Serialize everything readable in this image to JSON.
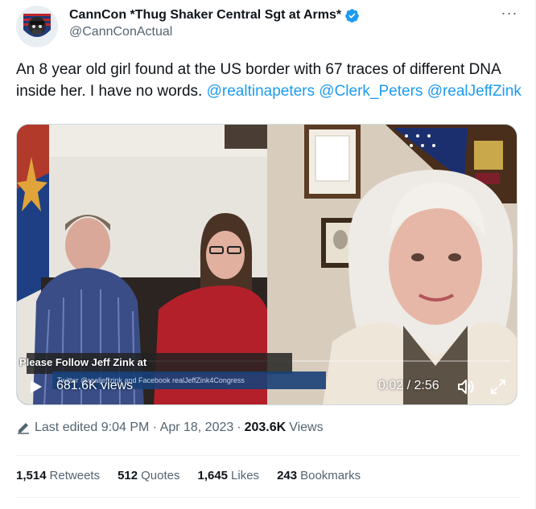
{
  "author": {
    "display_name": "CannCon *Thug Shaker Central Sgt at Arms*",
    "handle": "@CannConActual",
    "avatar_icon": "skull-flag-avatar-icon",
    "verified_color": "#1d9bf0"
  },
  "tweet": {
    "text": "An 8 year old girl found at the US border with 67 traces of different DNA inside her.   I have no words.",
    "mentions": [
      "@realtinapeters",
      "@Clerk_Peters",
      "@realJeffZink"
    ]
  },
  "video": {
    "overlay_title": "Please Follow Jeff Zink at",
    "overlay_subtitle": "Twitter @realjeffzink and Facebook realJeffZink4Congress",
    "views": "681.6K views",
    "time": "0:02 / 2:56",
    "play_icon": "play-icon",
    "volume_icon": "volume-icon",
    "fullscreen_icon": "fullscreen-icon"
  },
  "meta": {
    "edited": "Last edited 9:04 PM · Apr 18, 2023",
    "separator": "·",
    "view_count": "203.6K",
    "views_label": "Views"
  },
  "stats": [
    {
      "count": "1,514",
      "label": "Retweets"
    },
    {
      "count": "512",
      "label": "Quotes"
    },
    {
      "count": "1,645",
      "label": "Likes"
    },
    {
      "count": "243",
      "label": "Bookmarks"
    }
  ],
  "colors": {
    "accent": "#1d9bf0",
    "text": "#0f1419",
    "secondary": "#536471"
  }
}
